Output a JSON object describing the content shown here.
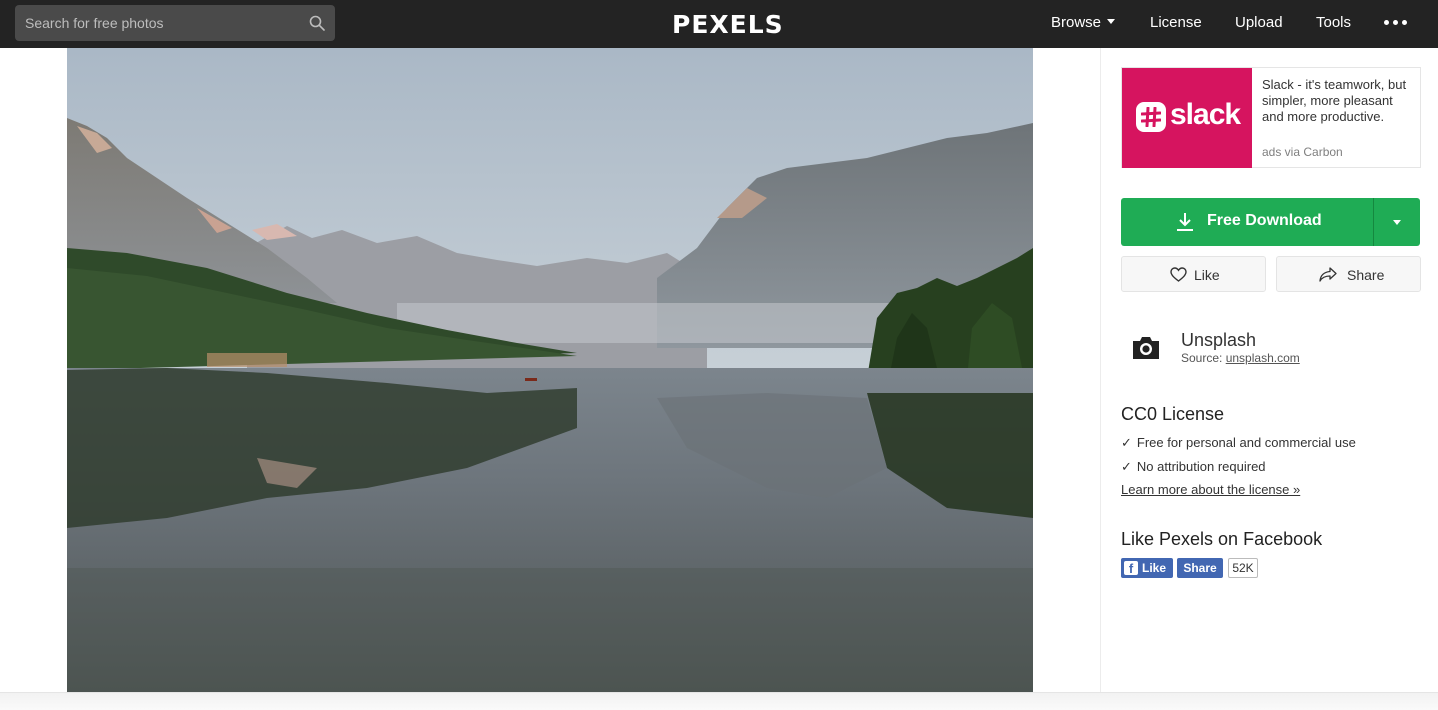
{
  "header": {
    "search_placeholder": "Search for free photos",
    "logo": "PEXELS",
    "nav": {
      "browse": "Browse",
      "license": "License",
      "upload": "Upload",
      "tools": "Tools"
    }
  },
  "photo": {
    "subject": "mountain-lake-reflection"
  },
  "ad": {
    "brand": "slack",
    "text": "Slack - it's teamwork, but simpler, more pleasant and more productive.",
    "via": "ads via Carbon",
    "brand_color": "#d6145f"
  },
  "actions": {
    "download_label": "Free Download",
    "like_label": "Like",
    "share_label": "Share",
    "accent_color": "#1fac55"
  },
  "source": {
    "name": "Unsplash",
    "source_prefix": "Source: ",
    "source_link": "unsplash.com"
  },
  "license": {
    "title": "CC0 License",
    "items": [
      "Free for personal and commercial use",
      "No attribution required"
    ],
    "link": "Learn more about the license »"
  },
  "facebook": {
    "title": "Like Pexels on Facebook",
    "like": "Like",
    "share": "Share",
    "count": "52K"
  }
}
